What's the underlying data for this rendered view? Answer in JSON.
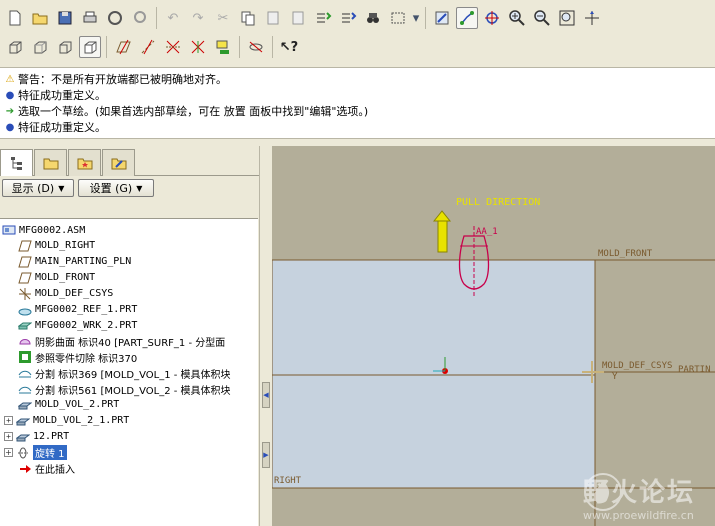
{
  "toolbar_row1": {
    "icons": [
      "new-icon",
      "open-icon",
      "save-icon",
      "print-icon",
      "send-icon",
      "view-icon",
      "undo-icon",
      "redo-icon",
      "cut-icon",
      "copy-icon",
      "paste-icon",
      "paste-special-icon",
      "regenerate-icon",
      "regenerate-manager-icon",
      "find-icon",
      "select-box-icon",
      "repaint-icon",
      "spin-center-icon",
      "orient-icon",
      "zoom-in-icon",
      "zoom-out-icon",
      "refit-icon",
      "rotate-icon"
    ]
  },
  "toolbar_row2": {
    "icons": [
      "wireframe-icon",
      "hidden-line-icon",
      "no-hidden-icon",
      "shading-icon",
      "datum-plane-icon",
      "datum-axis-icon",
      "datum-point-icon",
      "coordinate-system-icon",
      "annotation-icon",
      "visibility-icon",
      "whats-this-icon"
    ]
  },
  "messages": [
    {
      "type": "warn",
      "text": "警告：不是所有开放端都已被明确地对齐。"
    },
    {
      "type": "dot",
      "text": "特征成功重定义。"
    },
    {
      "type": "arrow",
      "text": "选取一个草绘。(如果首选内部草绘，可在 放置 面板中找到\"编辑\"选项。)"
    },
    {
      "type": "dot",
      "text": "特征成功重定义。"
    }
  ],
  "panel": {
    "show_button": "显示 (D)",
    "settings_button": "设置 (G)",
    "tree": [
      {
        "label": "MFG0002.ASM",
        "icon": "assembly-icon",
        "level": 0,
        "expand": ""
      },
      {
        "label": "MOLD_RIGHT",
        "icon": "datum-plane-icon",
        "level": 1,
        "expand": ""
      },
      {
        "label": "MAIN_PARTING_PLN",
        "icon": "datum-plane-icon",
        "level": 1,
        "expand": ""
      },
      {
        "label": "MOLD_FRONT",
        "icon": "datum-plane-icon",
        "level": 1,
        "expand": ""
      },
      {
        "label": "MOLD_DEF_CSYS",
        "icon": "csys-icon",
        "level": 1,
        "expand": ""
      },
      {
        "label": "MFG0002_REF_1.PRT",
        "icon": "ref-part-icon",
        "level": 1,
        "expand": ""
      },
      {
        "label": "MFG0002_WRK_2.PRT",
        "icon": "workpiece-icon",
        "level": 1,
        "expand": ""
      },
      {
        "label": "阴影曲面 标识40 [PART_SURF_1 - 分型面",
        "icon": "shadow-surface-icon",
        "level": 1,
        "expand": ""
      },
      {
        "label": "参照零件切除 标识370",
        "icon": "ref-cutout-icon",
        "level": 1,
        "expand": ""
      },
      {
        "label": "分割 标识369 [MOLD_VOL_1 - 模具体积块",
        "icon": "split-icon",
        "level": 1,
        "expand": ""
      },
      {
        "label": "分割 标识561 [MOLD_VOL_2 - 模具体积块",
        "icon": "split-icon",
        "level": 1,
        "expand": ""
      },
      {
        "label": "MOLD_VOL_2.PRT",
        "icon": "mold-part-icon",
        "level": 1,
        "expand": ""
      },
      {
        "label": "MOLD_VOL_2_1.PRT",
        "icon": "mold-part-icon",
        "level": 0,
        "expand": "+"
      },
      {
        "label": "12.PRT",
        "icon": "mold-part-icon",
        "level": 0,
        "expand": "+"
      },
      {
        "label": "旋转 1",
        "icon": "revolve-icon",
        "level": 0,
        "expand": "+",
        "selected": true
      },
      {
        "label": "在此插入",
        "icon": "insert-here-icon",
        "level": 1,
        "expand": ""
      }
    ]
  },
  "graphics": {
    "pull_direction": "PULL DIRECTION",
    "aa_label": "AA_1",
    "mold_front": "MOLD_FRONT",
    "mold_def_csys": "MOLD_DEF_CSYS",
    "parting": "PARTIN",
    "right": "RIGHT",
    "y_label": "Y",
    "colors": {
      "background": "#b3ae99",
      "mold_block": "#c6d2de",
      "datum": "#7a5a2e",
      "pull": "#e8e200",
      "sketch": "#c8004a"
    }
  },
  "watermark": {
    "text": "野火论坛",
    "url": "www.proewildfire.cn"
  }
}
